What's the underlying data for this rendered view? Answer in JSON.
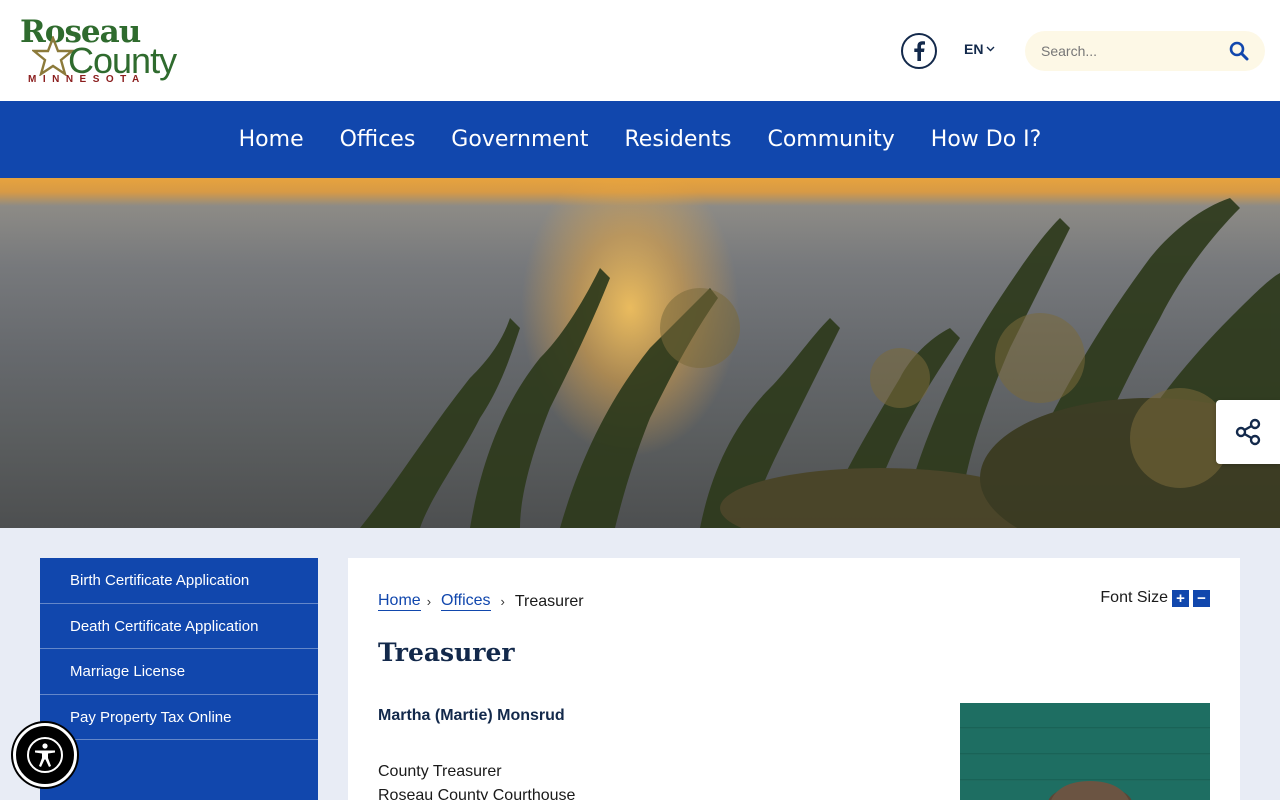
{
  "header": {
    "logo": {
      "line1": "Roseau",
      "line2": "County",
      "line3": "MINNESOTA"
    },
    "language": "EN",
    "search": {
      "placeholder": "Search..."
    }
  },
  "nav": {
    "items": [
      "Home",
      "Offices",
      "Government",
      "Residents",
      "Community",
      "How Do I?"
    ]
  },
  "sidebar": {
    "items": [
      "Birth Certificate Application",
      "Death Certificate Application",
      "Marriage License",
      "Pay Property Tax Online"
    ]
  },
  "breadcrumb": {
    "home": "Home",
    "offices": "Offices",
    "current": "Treasurer"
  },
  "font_size": {
    "label": "Font Size",
    "increase": "+",
    "decrease": "−"
  },
  "page": {
    "title": "Treasurer",
    "person_name": "Martha (Martie) Monsrud",
    "role": "County Treasurer",
    "location": "Roseau County Courthouse"
  },
  "colors": {
    "brand_blue": "#1147ad",
    "navy": "#13294b",
    "logo_green": "#2f6b2e",
    "logo_red": "#8a1c1c",
    "page_bg": "#e8ecf5"
  },
  "icons": {
    "facebook": "facebook-icon",
    "search": "search-icon",
    "share": "share-icon",
    "accessibility": "accessibility-icon"
  }
}
